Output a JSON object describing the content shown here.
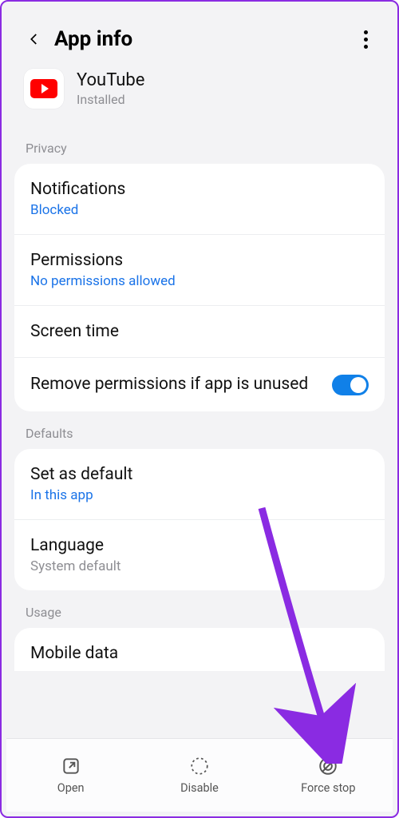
{
  "header": {
    "title": "App info"
  },
  "app": {
    "name": "YouTube",
    "status": "Installed"
  },
  "sections": {
    "privacy_label": "Privacy",
    "defaults_label": "Defaults",
    "usage_label": "Usage"
  },
  "privacy": {
    "notifications": {
      "title": "Notifications",
      "sub": "Blocked"
    },
    "permissions": {
      "title": "Permissions",
      "sub": "No permissions allowed"
    },
    "screen_time": {
      "title": "Screen time"
    },
    "remove_perm": {
      "title": "Remove permissions if app is unused",
      "on": true
    }
  },
  "defaults": {
    "set_default": {
      "title": "Set as default",
      "sub": "In this app"
    },
    "language": {
      "title": "Language",
      "sub": "System default"
    }
  },
  "usage": {
    "mobile_data": {
      "title": "Mobile data"
    }
  },
  "bottom": {
    "open": "Open",
    "disable": "Disable",
    "force_stop": "Force stop"
  },
  "colors": {
    "accent": "#1080e8",
    "link": "#1a73e8",
    "annotation": "#8a2be2"
  }
}
